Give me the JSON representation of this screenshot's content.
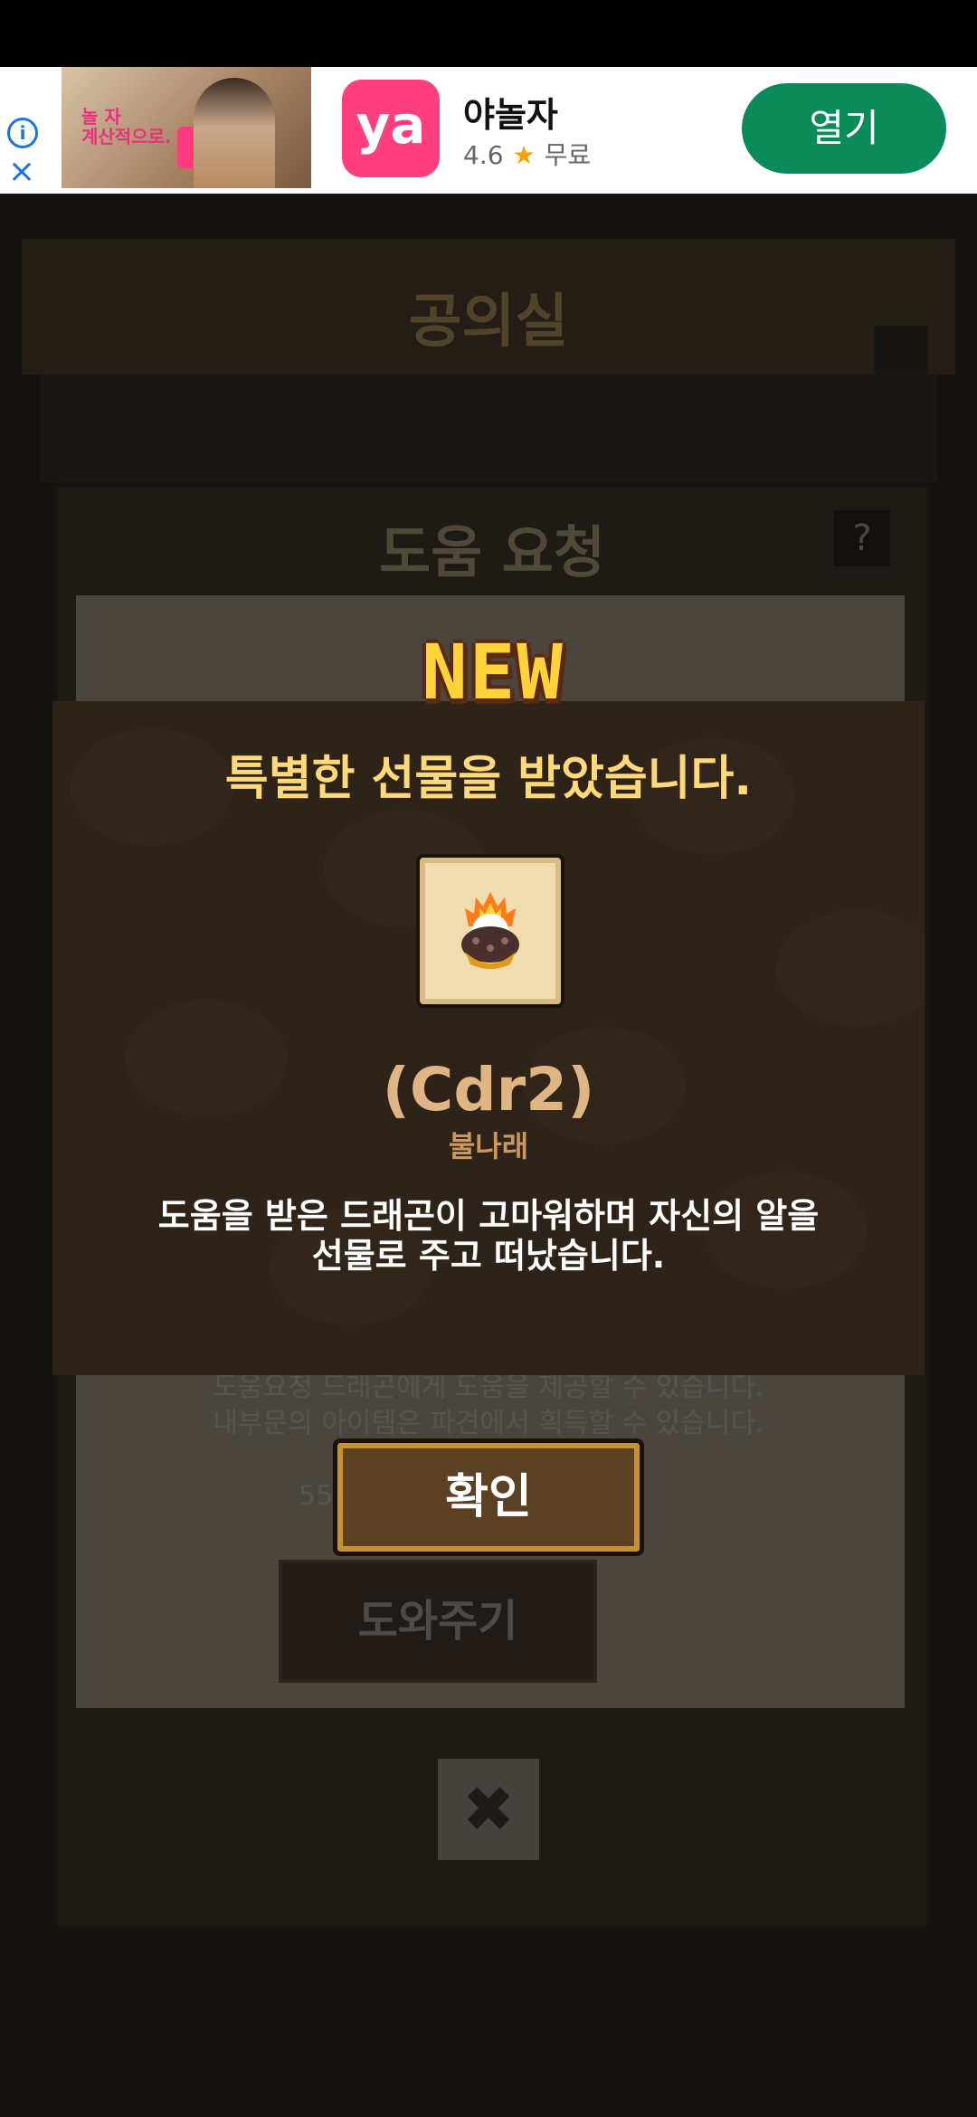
{
  "ad": {
    "app_name": "야놀자",
    "rating": "4.6",
    "price": "무료",
    "open_label": "열기",
    "logo_text": "ya",
    "photo_text": "놀 자\n계산적으로.",
    "info_icon": "info-icon",
    "close_icon": "close-icon"
  },
  "background": {
    "header_title": "공의실",
    "panel_title": "도움 요청",
    "help_glyph": "?",
    "help_button": "도와주기",
    "close_glyph": "✖",
    "text_line1": "도움요청 드래곤에게 도움을 제공할 수 있습니다.",
    "text_line2": "내부문의 아이템은 파견에서 획득할 수 있습니다.",
    "text_line3": "55"
  },
  "modal": {
    "badge": "NEW",
    "heading": "특별한 선물을 받았습니다.",
    "item_icon": "fire-dragon-egg-icon",
    "item_name": "(Cdr2)",
    "item_sub": "불나래",
    "desc_line1": "도움을 받은 드래곤이 고마워하며 자신의 알을",
    "desc_line2": "선물로 주고 떠났습니다.",
    "confirm_label": "확인"
  },
  "colors": {
    "modal_bg": "#2e2319",
    "heading": "#ffd978",
    "item_name": "#e0b585",
    "ad_button": "#0b8a5a",
    "ad_logo": "#ff3d7f"
  }
}
